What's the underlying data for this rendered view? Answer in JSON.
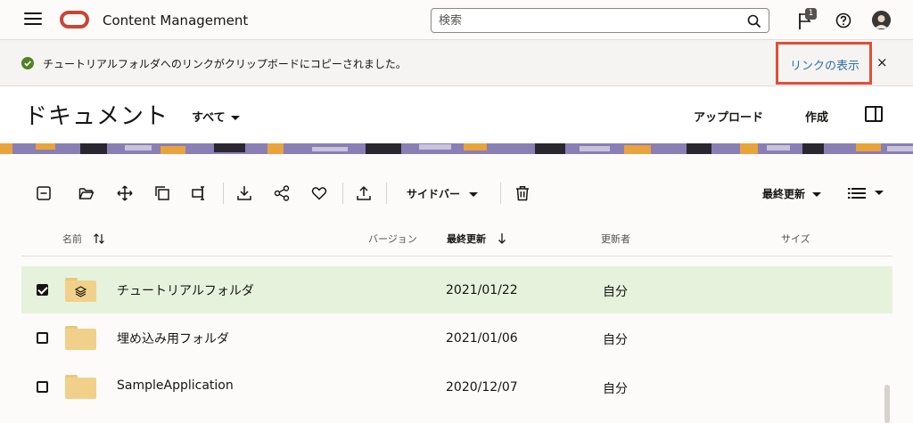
{
  "header": {
    "app_title": "Content Management",
    "search_placeholder": "検索",
    "notification_count": "1"
  },
  "notification": {
    "message": "チュートリアルフォルダへのリンクがクリップボードにコピーされました。",
    "link_label": "リンクの表示",
    "close_label": "×"
  },
  "page": {
    "title": "ドキュメント",
    "filter_label": "すべて",
    "upload_label": "アップロード",
    "create_label": "作成"
  },
  "toolbar": {
    "sidebar_label": "サイドバー",
    "sort_label": "最終更新"
  },
  "table": {
    "columns": {
      "name": "名前",
      "version": "バージョン",
      "modified": "最終更新",
      "modified_by": "更新者",
      "size": "サイズ"
    },
    "rows": [
      {
        "name": "チュートリアルフォルダ",
        "date": "2021/01/22",
        "owner": "自分",
        "selected": true
      },
      {
        "name": "埋め込み用フォルダ",
        "date": "2021/01/06",
        "owner": "自分",
        "selected": false
      },
      {
        "name": "SampleApplication",
        "date": "2020/12/07",
        "owner": "自分",
        "selected": false
      }
    ]
  },
  "colors": {
    "brand": "#c74634",
    "success": "#508223",
    "link": "#2f6fa8",
    "selected_row": "#e6f2dc",
    "folder": "#f1d189",
    "highlight_frame": "#e04e39"
  }
}
